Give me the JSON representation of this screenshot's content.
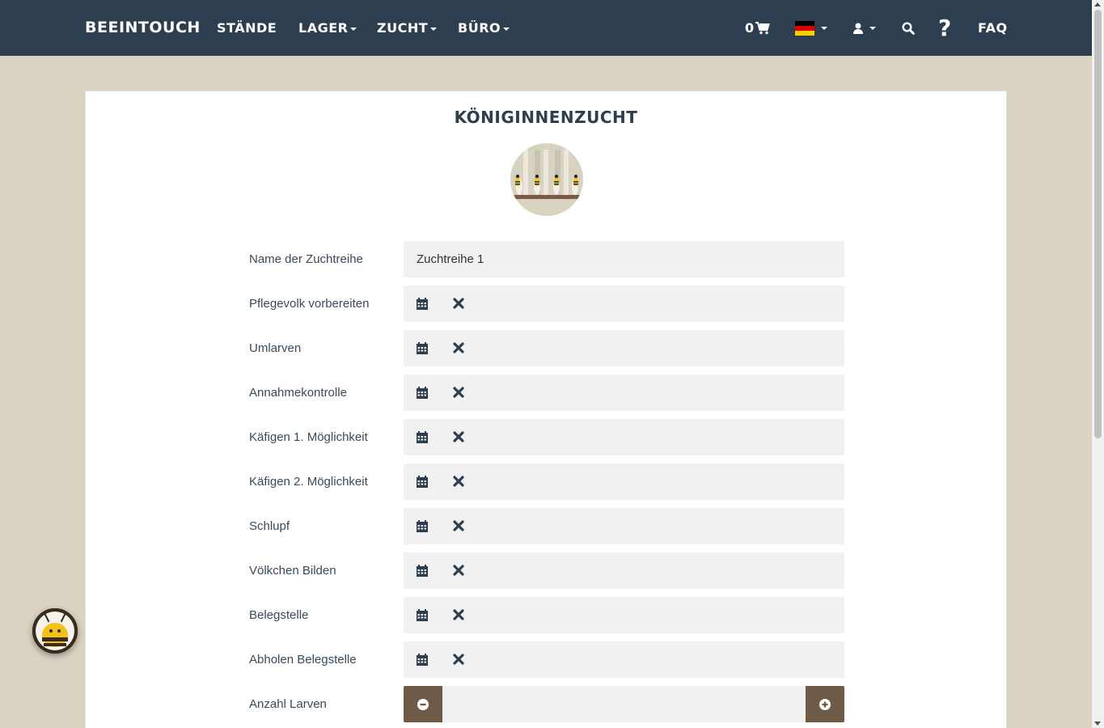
{
  "navbar": {
    "brand": "BEEINTOUCH",
    "items": [
      {
        "label": "STÄNDE",
        "dropdown": false
      },
      {
        "label": "LAGER",
        "dropdown": true
      },
      {
        "label": "ZUCHT",
        "dropdown": true
      },
      {
        "label": "BÜRO",
        "dropdown": true
      }
    ],
    "cart_count": "0",
    "faq_label": "FAQ",
    "icons": [
      "cart-icon",
      "flag-de-icon",
      "user-icon",
      "search-icon",
      "help-icon"
    ],
    "background_color": "#2c3e50"
  },
  "page": {
    "title": "KÖNIGINNENZUCHT",
    "hero_icon": "queen-cells-icon",
    "background_color": "#d9d3c2",
    "accent_color": "#6e5a47"
  },
  "form": {
    "name_label": "Name der Zuchtreihe",
    "name_value": "Zuchtreihe 1",
    "date_fields": [
      {
        "label": "Pflegevolk vorbereiten",
        "value": ""
      },
      {
        "label": "Umlarven",
        "value": ""
      },
      {
        "label": "Annahmekontrolle",
        "value": ""
      },
      {
        "label": "Käfigen 1. Möglichkeit",
        "value": ""
      },
      {
        "label": "Käfigen 2. Möglichkeit",
        "value": ""
      },
      {
        "label": "Schlupf",
        "value": ""
      },
      {
        "label": "Völkchen Bilden",
        "value": ""
      },
      {
        "label": "Belegstelle",
        "value": ""
      },
      {
        "label": "Abholen Belegstelle",
        "value": ""
      }
    ],
    "larvae_label": "Anzahl Larven",
    "larvae_value": ""
  }
}
